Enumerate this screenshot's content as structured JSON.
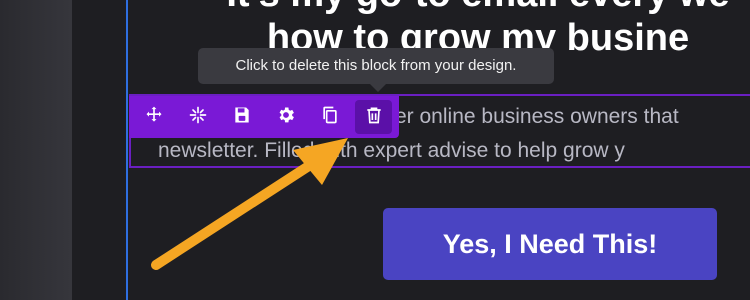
{
  "headline": {
    "line1": "It's my go-to email every we",
    "line2": "how to grow my busine"
  },
  "body": {
    "line1": "er online business owners that",
    "line2": "newsletter. Filled with expert advise to help grow y"
  },
  "tooltip": {
    "text": "Click to delete this block from your design."
  },
  "toolbar": {
    "items": [
      {
        "name": "move",
        "icon": "move-icon"
      },
      {
        "name": "animate",
        "icon": "sparkle-icon"
      },
      {
        "name": "save",
        "icon": "save-icon"
      },
      {
        "name": "settings",
        "icon": "gear-icon"
      },
      {
        "name": "duplicate",
        "icon": "copy-icon"
      },
      {
        "name": "delete",
        "icon": "trash-icon"
      }
    ]
  },
  "cta": {
    "label": "Yes, I Need This!"
  },
  "colors": {
    "toolbar": "#7a19d6",
    "cta": "#4a44c2",
    "arrow": "#f5a623",
    "guide": "#2f6fe0"
  }
}
